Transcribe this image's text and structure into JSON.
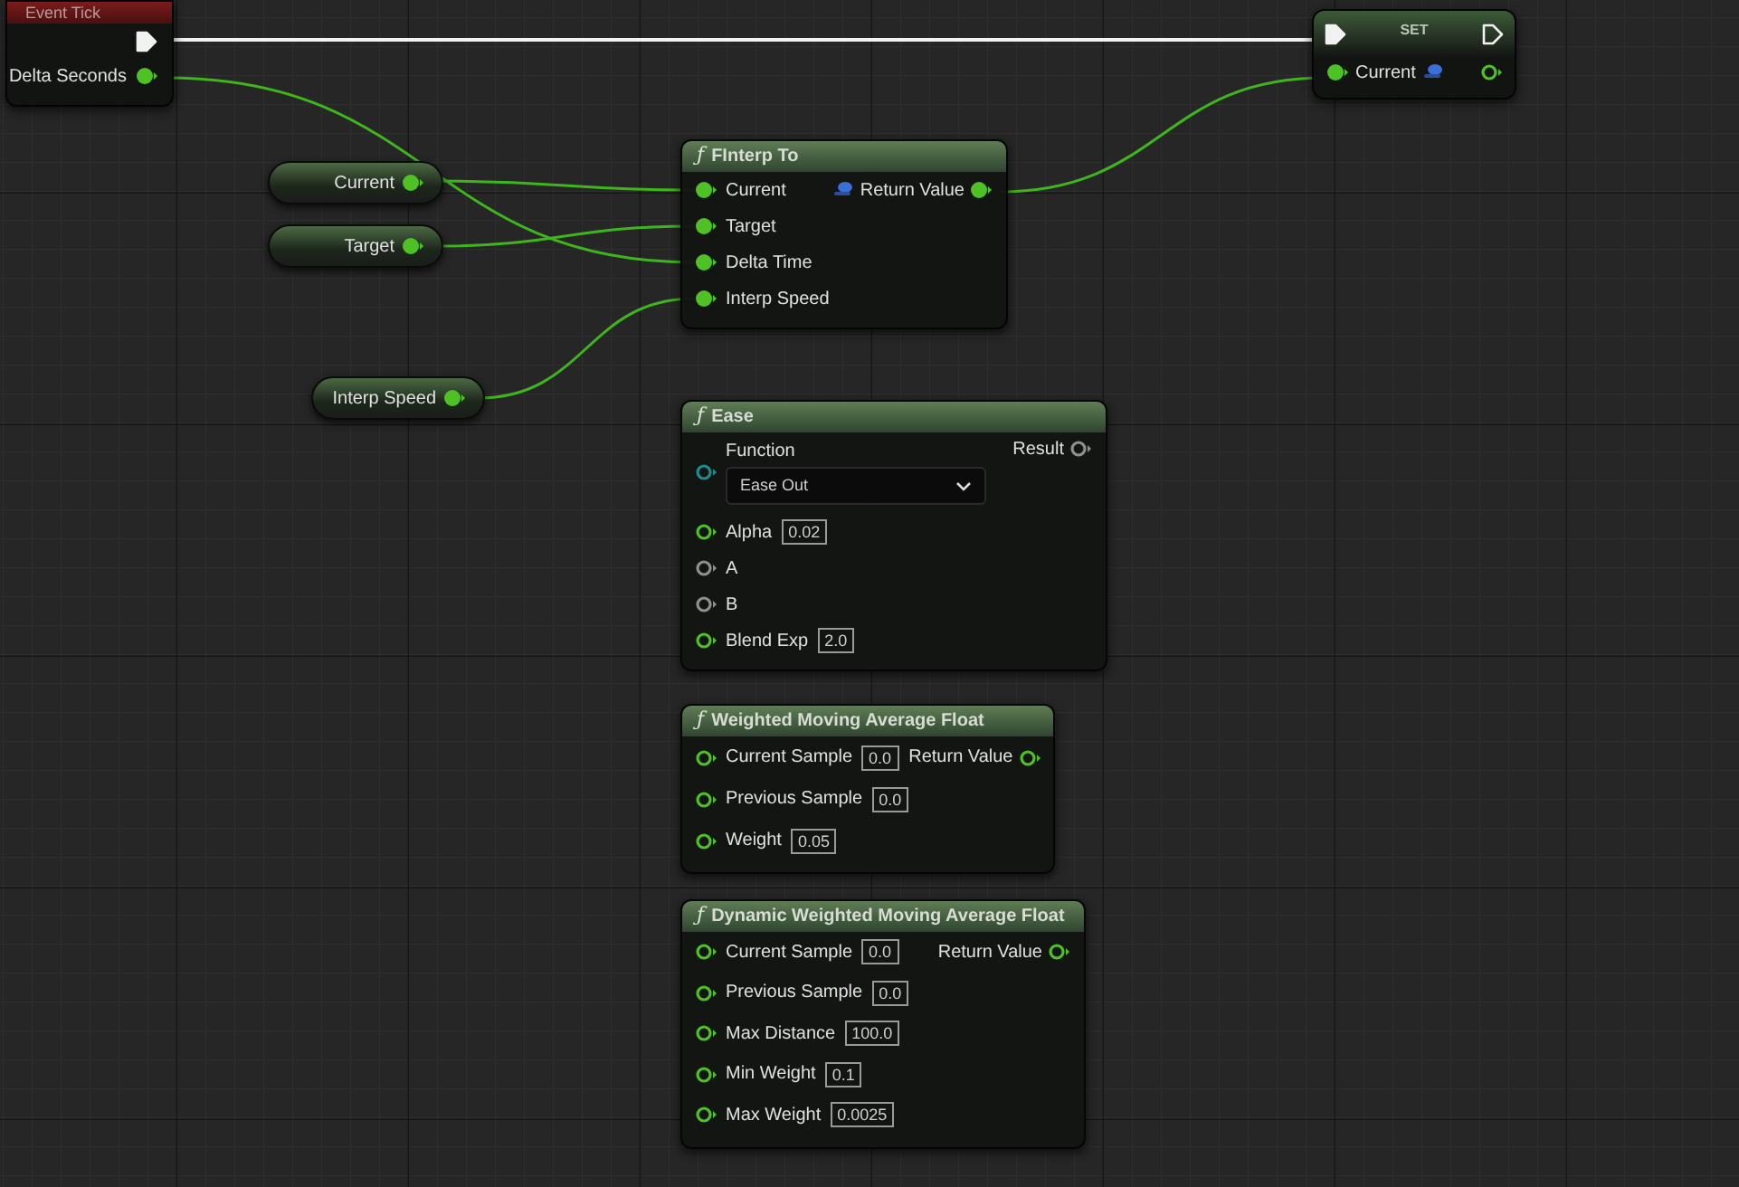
{
  "event_node": {
    "title": "Event Tick",
    "exec_connected": true,
    "output": {
      "label": "Delta Seconds",
      "connected": true,
      "color": "#4ec125"
    }
  },
  "set_node": {
    "title": "SET",
    "exec_in_connected": true,
    "exec_out_connected": false,
    "input": {
      "label": "Current",
      "connected": true,
      "color": "#4ec125"
    },
    "output": {
      "connected": false,
      "color": "#4ec125"
    }
  },
  "variables": [
    {
      "label": "Current",
      "connected": true,
      "color": "#4ec125"
    },
    {
      "label": "Target",
      "connected": true,
      "color": "#4ec125"
    },
    {
      "label": "Interp Speed",
      "connected": true,
      "color": "#4ec125"
    }
  ],
  "function_nodes": [
    {
      "title": "FInterp To",
      "icon": "ƒ",
      "inputs": [
        {
          "label": "Current",
          "connected": true,
          "color": "#4ec125"
        },
        {
          "label": "Target",
          "connected": true,
          "color": "#4ec125"
        },
        {
          "label": "Delta Time",
          "connected": true,
          "color": "#4ec125"
        },
        {
          "label": "Interp Speed",
          "connected": true,
          "color": "#4ec125"
        }
      ],
      "output": {
        "label": "Return Value",
        "connected": true,
        "color": "#4ec125",
        "variable": true
      }
    },
    {
      "title": "Ease",
      "icon": "ƒ",
      "enum_input": {
        "label": "Function",
        "value": "Ease Out",
        "connected": false,
        "color": "#1e8c8c"
      },
      "inputs": [
        {
          "label": "Alpha",
          "value": "0.02",
          "connected": false,
          "color": "#4ec125"
        },
        {
          "label": "A",
          "connected": false,
          "color": "#8f8f8f"
        },
        {
          "label": "B",
          "connected": false,
          "color": "#8f8f8f"
        },
        {
          "label": "Blend Exp",
          "value": "2.0",
          "connected": false,
          "color": "#4ec125"
        }
      ],
      "output": {
        "label": "Result",
        "connected": false,
        "color": "#8f8f8f",
        "variable": false
      }
    },
    {
      "title": "Weighted Moving Average Float",
      "icon": "ƒ",
      "inputs": [
        {
          "label": "Current Sample",
          "value": "0.0",
          "connected": false,
          "color": "#4ec125"
        },
        {
          "label": "Previous Sample",
          "value": "0.0",
          "connected": false,
          "color": "#4ec125"
        },
        {
          "label": "Weight",
          "value": "0.05",
          "connected": false,
          "color": "#4ec125"
        }
      ],
      "output": {
        "label": "Return Value",
        "connected": false,
        "color": "#4ec125",
        "variable": false
      }
    },
    {
      "title": "Dynamic Weighted Moving Average Float",
      "icon": "ƒ",
      "inputs": [
        {
          "label": "Current Sample",
          "value": "0.0",
          "connected": false,
          "color": "#4ec125"
        },
        {
          "label": "Previous Sample",
          "value": "0.0",
          "connected": false,
          "color": "#4ec125"
        },
        {
          "label": "Max Distance",
          "value": "100.0",
          "connected": false,
          "color": "#4ec125"
        },
        {
          "label": "Min Weight",
          "value": "0.1",
          "connected": false,
          "color": "#4ec125"
        },
        {
          "label": "Max Weight",
          "value": "0.0025",
          "connected": false,
          "color": "#4ec125"
        }
      ],
      "output": {
        "label": "Return Value",
        "connected": false,
        "color": "#4ec125",
        "variable": false
      }
    }
  ]
}
